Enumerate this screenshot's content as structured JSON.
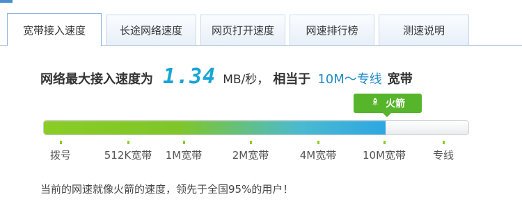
{
  "tabs": [
    {
      "label": "宽带接入速度",
      "active": true
    },
    {
      "label": "长途网络速度",
      "active": false
    },
    {
      "label": "网页打开速度",
      "active": false
    },
    {
      "label": "网速排行榜",
      "active": false
    },
    {
      "label": "测速说明",
      "active": false
    }
  ],
  "speed": {
    "prefix": "网络最大接入速度为",
    "value": "1.34",
    "unit": "MB/秒，",
    "compare_prefix": "相当于",
    "level": "10M～专线",
    "tail": "宽带"
  },
  "marker": {
    "icon": "rocket-icon",
    "label": "火箭"
  },
  "progress": {
    "fraction": 0.805,
    "fill_start_color": "#8bcc25",
    "fill_end_color": "#2da7e2"
  },
  "scale": [
    {
      "label": "拨号"
    },
    {
      "label": "512K宽带"
    },
    {
      "label": "1M宽带"
    },
    {
      "label": "2M宽带"
    },
    {
      "label": "4M宽带"
    },
    {
      "label": "10M宽带"
    },
    {
      "label": "专线"
    }
  ],
  "summary": "当前的网速就像火箭的速度，领先于全国95%的用户！"
}
